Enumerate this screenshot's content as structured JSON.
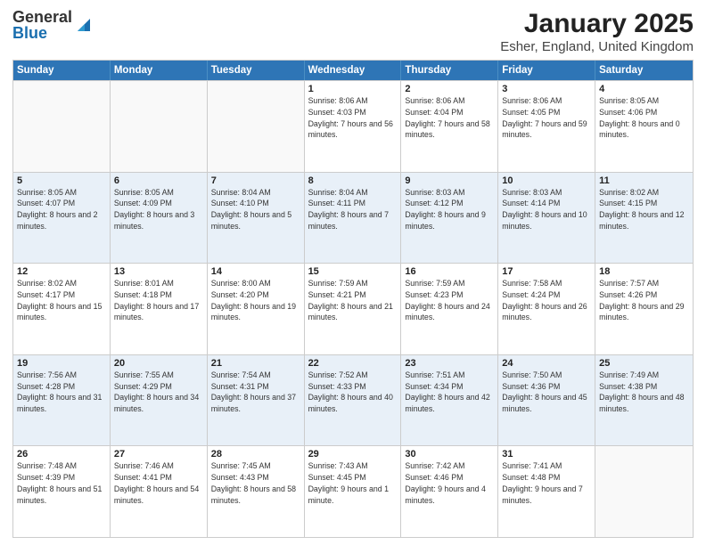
{
  "header": {
    "logo_general": "General",
    "logo_blue": "Blue",
    "title": "January 2025",
    "subtitle": "Esher, England, United Kingdom"
  },
  "weekdays": [
    "Sunday",
    "Monday",
    "Tuesday",
    "Wednesday",
    "Thursday",
    "Friday",
    "Saturday"
  ],
  "weeks": [
    [
      {
        "day": "",
        "sunrise": "",
        "sunset": "",
        "daylight": "",
        "empty": true
      },
      {
        "day": "",
        "sunrise": "",
        "sunset": "",
        "daylight": "",
        "empty": true
      },
      {
        "day": "",
        "sunrise": "",
        "sunset": "",
        "daylight": "",
        "empty": true
      },
      {
        "day": "1",
        "sunrise": "Sunrise: 8:06 AM",
        "sunset": "Sunset: 4:03 PM",
        "daylight": "Daylight: 7 hours and 56 minutes.",
        "empty": false
      },
      {
        "day": "2",
        "sunrise": "Sunrise: 8:06 AM",
        "sunset": "Sunset: 4:04 PM",
        "daylight": "Daylight: 7 hours and 58 minutes.",
        "empty": false
      },
      {
        "day": "3",
        "sunrise": "Sunrise: 8:06 AM",
        "sunset": "Sunset: 4:05 PM",
        "daylight": "Daylight: 7 hours and 59 minutes.",
        "empty": false
      },
      {
        "day": "4",
        "sunrise": "Sunrise: 8:05 AM",
        "sunset": "Sunset: 4:06 PM",
        "daylight": "Daylight: 8 hours and 0 minutes.",
        "empty": false
      }
    ],
    [
      {
        "day": "5",
        "sunrise": "Sunrise: 8:05 AM",
        "sunset": "Sunset: 4:07 PM",
        "daylight": "Daylight: 8 hours and 2 minutes.",
        "empty": false
      },
      {
        "day": "6",
        "sunrise": "Sunrise: 8:05 AM",
        "sunset": "Sunset: 4:09 PM",
        "daylight": "Daylight: 8 hours and 3 minutes.",
        "empty": false
      },
      {
        "day": "7",
        "sunrise": "Sunrise: 8:04 AM",
        "sunset": "Sunset: 4:10 PM",
        "daylight": "Daylight: 8 hours and 5 minutes.",
        "empty": false
      },
      {
        "day": "8",
        "sunrise": "Sunrise: 8:04 AM",
        "sunset": "Sunset: 4:11 PM",
        "daylight": "Daylight: 8 hours and 7 minutes.",
        "empty": false
      },
      {
        "day": "9",
        "sunrise": "Sunrise: 8:03 AM",
        "sunset": "Sunset: 4:12 PM",
        "daylight": "Daylight: 8 hours and 9 minutes.",
        "empty": false
      },
      {
        "day": "10",
        "sunrise": "Sunrise: 8:03 AM",
        "sunset": "Sunset: 4:14 PM",
        "daylight": "Daylight: 8 hours and 10 minutes.",
        "empty": false
      },
      {
        "day": "11",
        "sunrise": "Sunrise: 8:02 AM",
        "sunset": "Sunset: 4:15 PM",
        "daylight": "Daylight: 8 hours and 12 minutes.",
        "empty": false
      }
    ],
    [
      {
        "day": "12",
        "sunrise": "Sunrise: 8:02 AM",
        "sunset": "Sunset: 4:17 PM",
        "daylight": "Daylight: 8 hours and 15 minutes.",
        "empty": false
      },
      {
        "day": "13",
        "sunrise": "Sunrise: 8:01 AM",
        "sunset": "Sunset: 4:18 PM",
        "daylight": "Daylight: 8 hours and 17 minutes.",
        "empty": false
      },
      {
        "day": "14",
        "sunrise": "Sunrise: 8:00 AM",
        "sunset": "Sunset: 4:20 PM",
        "daylight": "Daylight: 8 hours and 19 minutes.",
        "empty": false
      },
      {
        "day": "15",
        "sunrise": "Sunrise: 7:59 AM",
        "sunset": "Sunset: 4:21 PM",
        "daylight": "Daylight: 8 hours and 21 minutes.",
        "empty": false
      },
      {
        "day": "16",
        "sunrise": "Sunrise: 7:59 AM",
        "sunset": "Sunset: 4:23 PM",
        "daylight": "Daylight: 8 hours and 24 minutes.",
        "empty": false
      },
      {
        "day": "17",
        "sunrise": "Sunrise: 7:58 AM",
        "sunset": "Sunset: 4:24 PM",
        "daylight": "Daylight: 8 hours and 26 minutes.",
        "empty": false
      },
      {
        "day": "18",
        "sunrise": "Sunrise: 7:57 AM",
        "sunset": "Sunset: 4:26 PM",
        "daylight": "Daylight: 8 hours and 29 minutes.",
        "empty": false
      }
    ],
    [
      {
        "day": "19",
        "sunrise": "Sunrise: 7:56 AM",
        "sunset": "Sunset: 4:28 PM",
        "daylight": "Daylight: 8 hours and 31 minutes.",
        "empty": false
      },
      {
        "day": "20",
        "sunrise": "Sunrise: 7:55 AM",
        "sunset": "Sunset: 4:29 PM",
        "daylight": "Daylight: 8 hours and 34 minutes.",
        "empty": false
      },
      {
        "day": "21",
        "sunrise": "Sunrise: 7:54 AM",
        "sunset": "Sunset: 4:31 PM",
        "daylight": "Daylight: 8 hours and 37 minutes.",
        "empty": false
      },
      {
        "day": "22",
        "sunrise": "Sunrise: 7:52 AM",
        "sunset": "Sunset: 4:33 PM",
        "daylight": "Daylight: 8 hours and 40 minutes.",
        "empty": false
      },
      {
        "day": "23",
        "sunrise": "Sunrise: 7:51 AM",
        "sunset": "Sunset: 4:34 PM",
        "daylight": "Daylight: 8 hours and 42 minutes.",
        "empty": false
      },
      {
        "day": "24",
        "sunrise": "Sunrise: 7:50 AM",
        "sunset": "Sunset: 4:36 PM",
        "daylight": "Daylight: 8 hours and 45 minutes.",
        "empty": false
      },
      {
        "day": "25",
        "sunrise": "Sunrise: 7:49 AM",
        "sunset": "Sunset: 4:38 PM",
        "daylight": "Daylight: 8 hours and 48 minutes.",
        "empty": false
      }
    ],
    [
      {
        "day": "26",
        "sunrise": "Sunrise: 7:48 AM",
        "sunset": "Sunset: 4:39 PM",
        "daylight": "Daylight: 8 hours and 51 minutes.",
        "empty": false
      },
      {
        "day": "27",
        "sunrise": "Sunrise: 7:46 AM",
        "sunset": "Sunset: 4:41 PM",
        "daylight": "Daylight: 8 hours and 54 minutes.",
        "empty": false
      },
      {
        "day": "28",
        "sunrise": "Sunrise: 7:45 AM",
        "sunset": "Sunset: 4:43 PM",
        "daylight": "Daylight: 8 hours and 58 minutes.",
        "empty": false
      },
      {
        "day": "29",
        "sunrise": "Sunrise: 7:43 AM",
        "sunset": "Sunset: 4:45 PM",
        "daylight": "Daylight: 9 hours and 1 minute.",
        "empty": false
      },
      {
        "day": "30",
        "sunrise": "Sunrise: 7:42 AM",
        "sunset": "Sunset: 4:46 PM",
        "daylight": "Daylight: 9 hours and 4 minutes.",
        "empty": false
      },
      {
        "day": "31",
        "sunrise": "Sunrise: 7:41 AM",
        "sunset": "Sunset: 4:48 PM",
        "daylight": "Daylight: 9 hours and 7 minutes.",
        "empty": false
      },
      {
        "day": "",
        "sunrise": "",
        "sunset": "",
        "daylight": "",
        "empty": true
      }
    ]
  ],
  "alt_rows": [
    1,
    3
  ]
}
